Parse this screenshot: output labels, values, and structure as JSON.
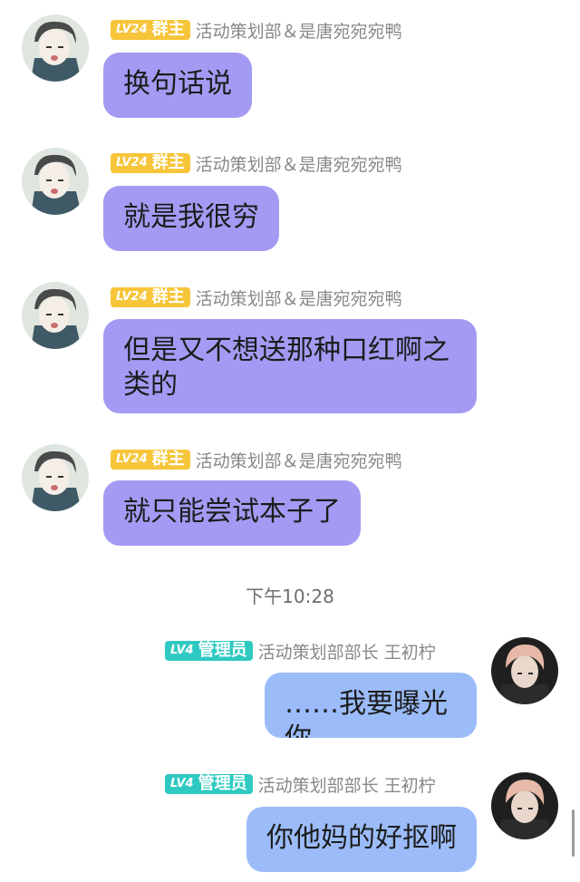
{
  "messages": [
    {
      "level": "LV24",
      "role": "群主",
      "sender": "活动策划部＆是唐宛宛宛鸭",
      "text": "换句话说"
    },
    {
      "level": "LV24",
      "role": "群主",
      "sender": "活动策划部＆是唐宛宛宛鸭",
      "text": "就是我很穷"
    },
    {
      "level": "LV24",
      "role": "群主",
      "sender": "活动策划部＆是唐宛宛宛鸭",
      "text": "但是又不想送那种口红啊之类的"
    },
    {
      "level": "LV24",
      "role": "群主",
      "sender": "活动策划部＆是唐宛宛宛鸭",
      "text": "就只能尝试本子了"
    },
    {
      "level": "LV4",
      "role": "管理员",
      "sender": "活动策划部部长 王初柠",
      "text": "……我要曝光你"
    },
    {
      "level": "LV4",
      "role": "管理员",
      "sender": "活动策划部部长 王初柠",
      "text": "你他妈的好抠啊"
    }
  ],
  "timestamp": "下午10:28",
  "colors": {
    "owner_badge": "#f7c53a",
    "admin_badge": "#2fc9c2",
    "left_bubble": "#a39bf3",
    "right_bubble": "#9bbcf9"
  }
}
